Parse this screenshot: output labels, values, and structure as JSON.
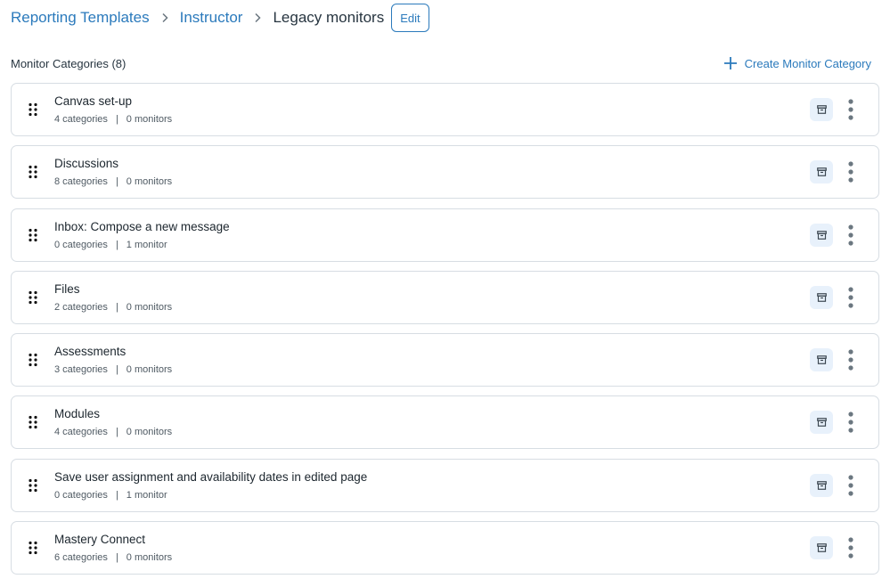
{
  "breadcrumb": {
    "items": [
      {
        "label": "Reporting Templates",
        "link": true
      },
      {
        "label": "Instructor",
        "link": true
      }
    ],
    "current": "Legacy monitors",
    "edit_label": "Edit"
  },
  "section": {
    "title": "Monitor Categories (8)",
    "create_label": "Create Monitor Category"
  },
  "colors": {
    "link": "#2b7abc",
    "archive_bg": "#e8f1fb",
    "border": "#d7dde3"
  },
  "icons": {
    "drag": "drag-handle-icon",
    "archive": "archive-icon",
    "more": "more-vertical-icon",
    "plus": "plus-icon",
    "chevron": "chevron-right-icon"
  },
  "categories": [
    {
      "title": "Canvas set-up",
      "categories": "4 categories",
      "monitors": "0 monitors"
    },
    {
      "title": "Discussions",
      "categories": "8 categories",
      "monitors": "0 monitors"
    },
    {
      "title": "Inbox: Compose a new message",
      "categories": "0 categories",
      "monitors": "1 monitor"
    },
    {
      "title": "Files",
      "categories": "2 categories",
      "monitors": "0 monitors"
    },
    {
      "title": "Assessments",
      "categories": "3 categories",
      "monitors": "0 monitors"
    },
    {
      "title": "Modules",
      "categories": "4 categories",
      "monitors": "0 monitors"
    },
    {
      "title": "Save user assignment and availability dates in edited page",
      "categories": "0 categories",
      "monitors": "1 monitor"
    },
    {
      "title": "Mastery Connect",
      "categories": "6 categories",
      "monitors": "0 monitors"
    }
  ],
  "meta_separator": "|"
}
